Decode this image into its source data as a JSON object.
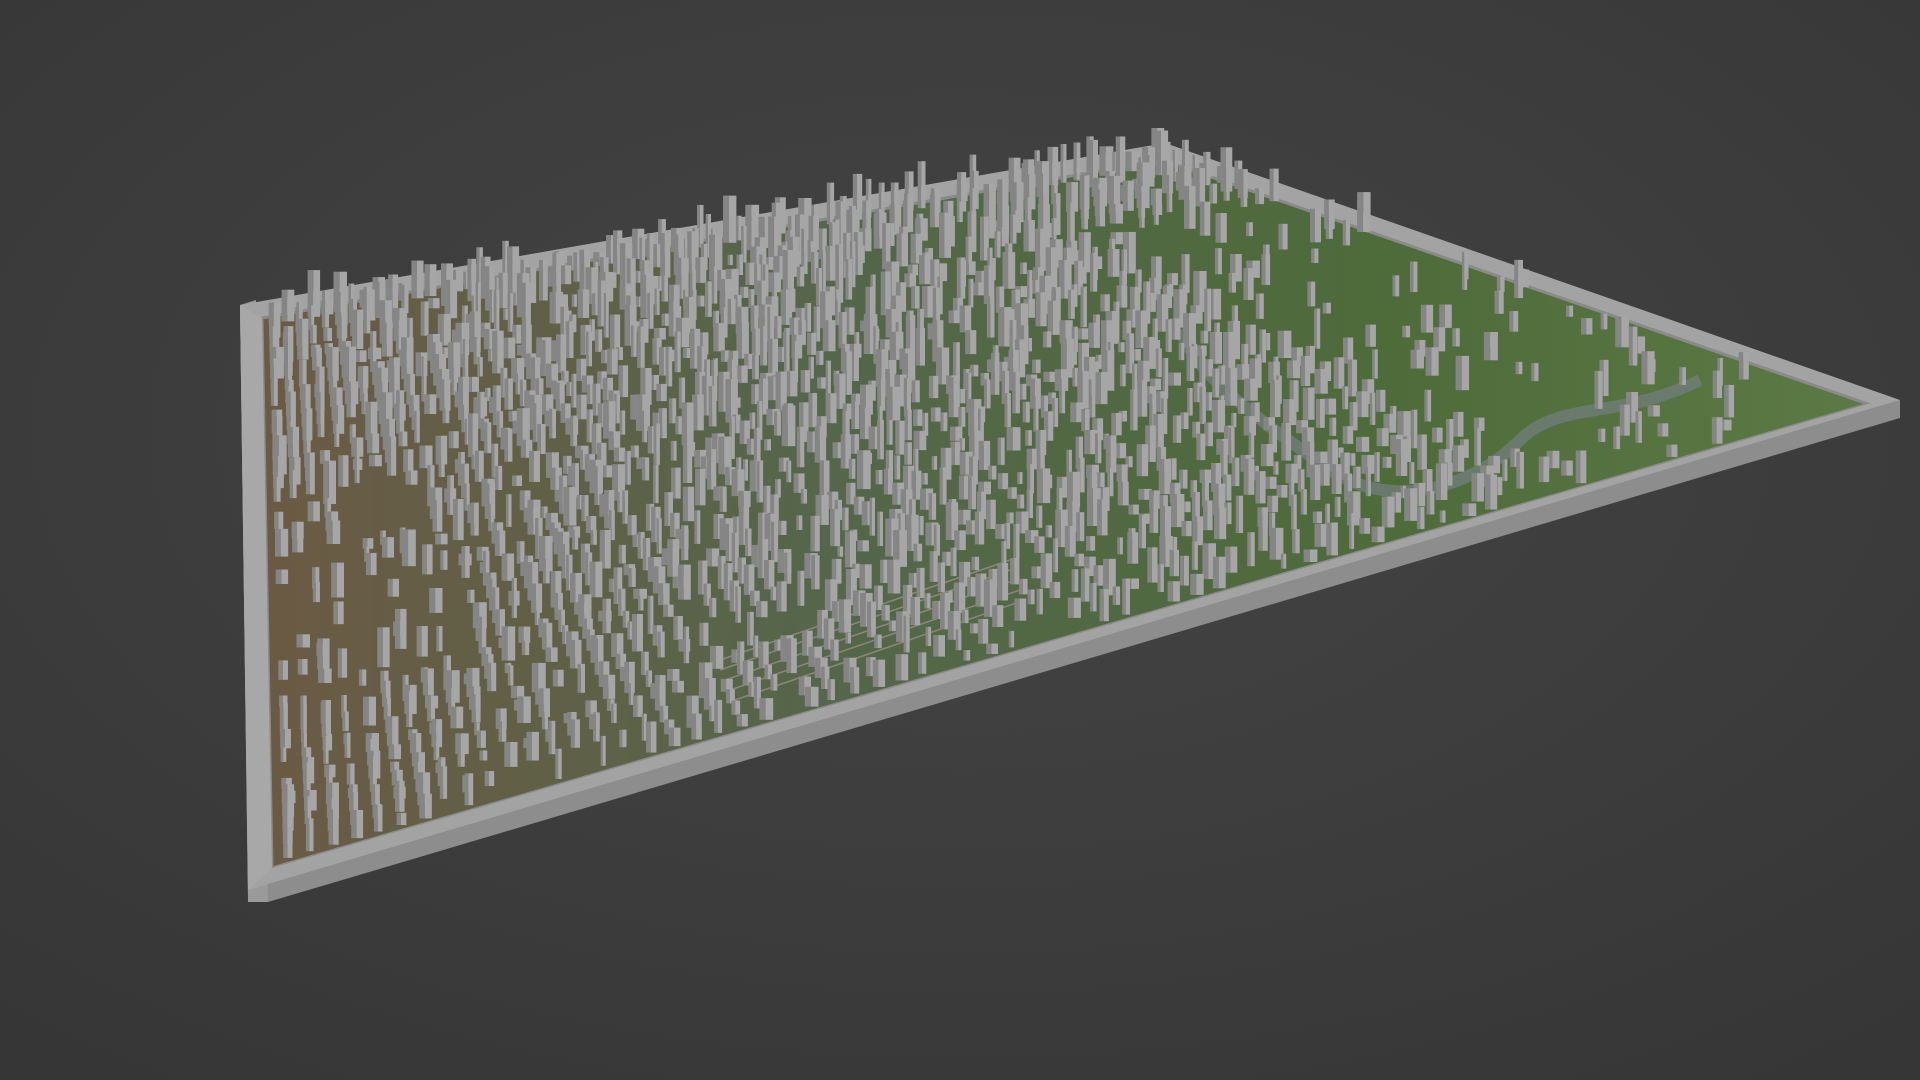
{
  "scene": {
    "subject": "3d-city-model",
    "background_color": "#3c3c3c",
    "frame_color": "#a3a3a3",
    "frame_shadow_color": "#8d8d8d",
    "building_color": "#a6a6a6",
    "building_shade_color": "#858585",
    "ground_green": "#4e6b3a",
    "ground_brown": "#6b5a44",
    "river_color": "#6e7d76"
  }
}
